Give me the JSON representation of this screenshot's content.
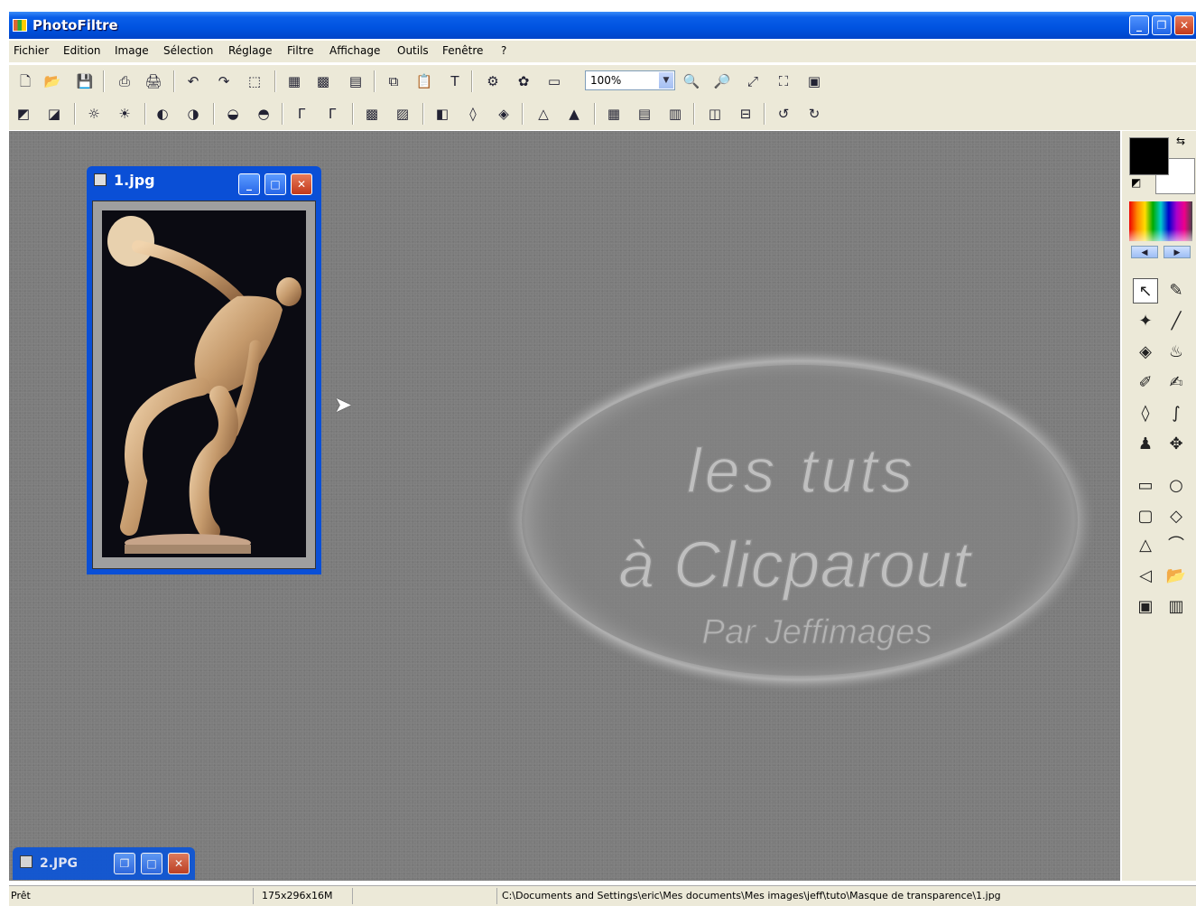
{
  "window": {
    "title": "PhotoFiltre",
    "buttons": [
      {
        "label": "_"
      },
      {
        "label": "❐"
      },
      {
        "label": "✕"
      }
    ]
  },
  "menu": [
    {
      "label": "Fichier"
    },
    {
      "label": "Edition"
    },
    {
      "label": "Image"
    },
    {
      "label": "Sélection"
    },
    {
      "label": "Réglage"
    },
    {
      "label": "Filtre"
    },
    {
      "label": "Affichage"
    },
    {
      "label": "Outils"
    },
    {
      "label": "Fenêtre"
    },
    {
      "label": "?"
    }
  ],
  "toolbar1": {
    "zoom_value": "100%",
    "icons": [
      "new-file-icon",
      "open-file-icon",
      "save-icon",
      "print-icon",
      "scanner-icon",
      "undo-icon",
      "redo-icon",
      "select-all-icon",
      "image-size-icon",
      "colors-icon",
      "properties-icon",
      "copy-icon",
      "paste-icon",
      "text-icon",
      "plugin-icon",
      "automation-icon",
      "fullscreen-icon",
      "zoom-in-icon",
      "zoom-out-icon",
      "fit-window-icon",
      "actual-size-icon",
      "slideshow-icon"
    ]
  },
  "toolbar2": {
    "icons": [
      "auto-levels-icon",
      "auto-contrast-icon",
      "brightness-minus-icon",
      "brightness-plus-icon",
      "contrast-minus-icon",
      "contrast-plus-icon",
      "saturation-minus-icon",
      "saturation-plus-icon",
      "gamma-minus-icon",
      "gamma-plus-icon",
      "grayscale-icon",
      "sepia-icon",
      "invert-icon",
      "blur-icon",
      "soften-icon",
      "sharpen-icon",
      "sharpen-more-icon",
      "effect-1-icon",
      "effect-2-icon",
      "effect-3-icon",
      "flip-horizontal-icon",
      "flip-vertical-icon",
      "rotate-left-icon",
      "rotate-right-icon"
    ]
  },
  "palette": {
    "foreground": "#000000",
    "background": "#ffffff",
    "tools": [
      {
        "name": "pointer-tool",
        "glyph": "↖"
      },
      {
        "name": "eyedropper-tool",
        "glyph": "✎"
      },
      {
        "name": "magic-wand-tool",
        "glyph": "✦"
      },
      {
        "name": "line-tool",
        "glyph": "╱"
      },
      {
        "name": "fill-tool",
        "glyph": "◈"
      },
      {
        "name": "spray-tool",
        "glyph": "♨"
      },
      {
        "name": "brush-tool",
        "glyph": "✐"
      },
      {
        "name": "advanced-brush-tool",
        "glyph": "✍"
      },
      {
        "name": "blur-tool",
        "glyph": "◊"
      },
      {
        "name": "smudge-tool",
        "glyph": "∫"
      },
      {
        "name": "clone-stamp-tool",
        "glyph": "♟"
      },
      {
        "name": "move-tool",
        "glyph": "✥"
      },
      {
        "name": "rectangle-tool",
        "glyph": "▭"
      },
      {
        "name": "ellipse-tool",
        "glyph": "○"
      },
      {
        "name": "rounded-rectangle-tool",
        "glyph": "▢"
      },
      {
        "name": "rhombus-tool",
        "glyph": "◇"
      },
      {
        "name": "triangle-tool",
        "glyph": "△"
      },
      {
        "name": "lasso-tool",
        "glyph": "⌒"
      },
      {
        "name": "polygon-lasso-tool",
        "glyph": "◁"
      },
      {
        "name": "load-shape-tool",
        "glyph": "📂"
      },
      {
        "name": "selection-mode-tool",
        "glyph": "▣"
      },
      {
        "name": "invert-mode-tool",
        "glyph": "▥"
      }
    ]
  },
  "document1": {
    "title": "1.jpg"
  },
  "document2": {
    "title": "2.JPG"
  },
  "watermark": {
    "line1": "les tuts",
    "line2": "à Clicparout",
    "line3": "Par Jeffimages"
  },
  "status": {
    "state": "Prêt",
    "dimensions": "175x296x16M",
    "path": "C:\\Documents and Settings\\eric\\Mes documents\\Mes images\\jeff\\tuto\\Masque de transparence\\1.jpg"
  }
}
